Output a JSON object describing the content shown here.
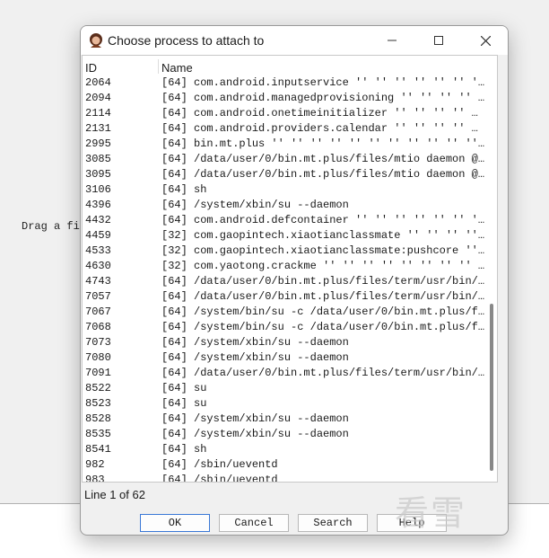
{
  "background": {
    "partial_text": "Drag a fi"
  },
  "dialog": {
    "title": "Choose process to attach to",
    "columns": {
      "id": "ID",
      "name": "Name"
    },
    "rows": [
      {
        "id": "2064",
        "name": "[64] com.android.inputservice '' '' '' '' '' '' '' …"
      },
      {
        "id": "2094",
        "name": "[64] com.android.managedprovisioning '' '' '' '' …"
      },
      {
        "id": "2114",
        "name": "[64] com.android.onetimeinitializer '' '' '' '' …"
      },
      {
        "id": "2131",
        "name": "[64] com.android.providers.calendar '' '' '' '' …"
      },
      {
        "id": "2995",
        "name": "[64] bin.mt.plus '' '' '' '' '' '' '' '' '' '' '' '' '' …"
      },
      {
        "id": "3085",
        "name": "[64] /data/user/0/bin.mt.plus/files/mtio daemon @…"
      },
      {
        "id": "3095",
        "name": "[64] /data/user/0/bin.mt.plus/files/mtio daemon @…"
      },
      {
        "id": "3106",
        "name": "[64] sh"
      },
      {
        "id": "4396",
        "name": "[64] /system/xbin/su --daemon"
      },
      {
        "id": "4432",
        "name": "[64] com.android.defcontainer '' '' '' '' '' '' '' …"
      },
      {
        "id": "4459",
        "name": "[32] com.gaopintech.xiaotianclassmate '' '' '' '' …"
      },
      {
        "id": "4533",
        "name": "[32] com.gaopintech.xiaotianclassmate:pushcore '' …"
      },
      {
        "id": "4630",
        "name": "[32] com.yaotong.crackme '' '' '' '' '' '' '' '' '' …"
      },
      {
        "id": "4743",
        "name": "[64] /data/user/0/bin.mt.plus/files/term/usr/bin/…"
      },
      {
        "id": "7057",
        "name": "[64] /data/user/0/bin.mt.plus/files/term/usr/bin/…"
      },
      {
        "id": "7067",
        "name": "[64] /system/bin/su -c /data/user/0/bin.mt.plus/f…"
      },
      {
        "id": "7068",
        "name": "[64] /system/bin/su -c /data/user/0/bin.mt.plus/f…"
      },
      {
        "id": "7073",
        "name": "[64] /system/xbin/su --daemon"
      },
      {
        "id": "7080",
        "name": "[64] /system/xbin/su --daemon"
      },
      {
        "id": "7091",
        "name": "[64] /data/user/0/bin.mt.plus/files/term/usr/bin/…"
      },
      {
        "id": "8522",
        "name": "[64] su"
      },
      {
        "id": "8523",
        "name": "[64] su"
      },
      {
        "id": "8528",
        "name": "[64] /system/xbin/su --daemon"
      },
      {
        "id": "8535",
        "name": "[64] /system/xbin/su --daemon"
      },
      {
        "id": "8541",
        "name": "[64] sh"
      },
      {
        "id": "982",
        "name": "[64] /sbin/ueventd"
      },
      {
        "id": "983",
        "name": "[64] /sbin/ueventd"
      }
    ],
    "status": "Line 1 of 62",
    "buttons": {
      "ok": "OK",
      "cancel": "Cancel",
      "search": "Search",
      "help": "Help"
    }
  },
  "watermark": "看雪",
  "colors": {
    "default_button_border": "#3a78d6",
    "scroll_thumb": "#888888"
  },
  "icons": {
    "app": "ida-avatar-icon",
    "minimize": "minimize-icon",
    "maximize": "maximize-icon",
    "close": "close-icon"
  }
}
